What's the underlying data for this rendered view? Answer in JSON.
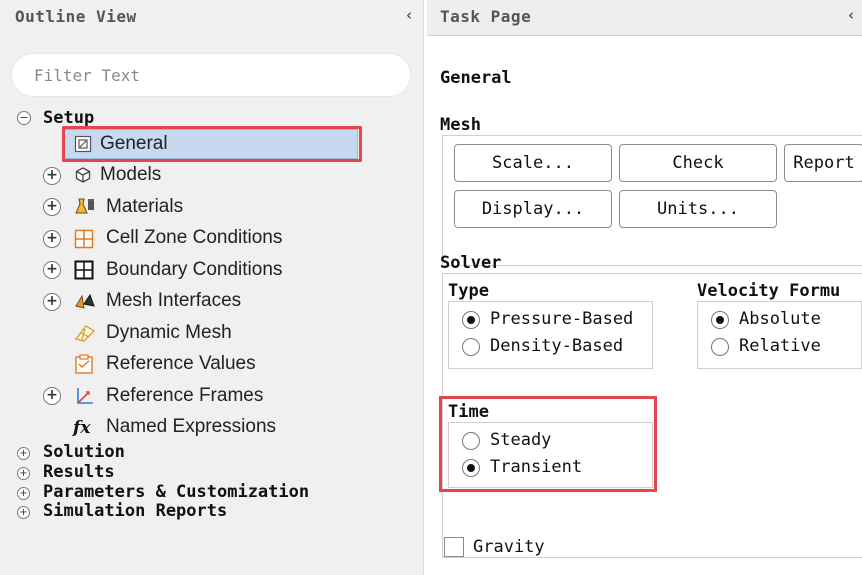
{
  "outline": {
    "title": "Outline View",
    "collapse_glyph": "‹",
    "filter_placeholder": "Filter Text",
    "setup": {
      "toggle": "−",
      "label": "Setup",
      "items": [
        {
          "label": "General",
          "icon": "general-icon"
        },
        {
          "label": "Models",
          "icon": "models-icon"
        },
        {
          "label": "Materials",
          "icon": "materials-icon"
        },
        {
          "label": "Cell Zone Conditions",
          "icon": "cell-zone-icon"
        },
        {
          "label": "Boundary Conditions",
          "icon": "boundary-icon"
        },
        {
          "label": "Mesh Interfaces",
          "icon": "mesh-interfaces-icon"
        },
        {
          "label": "Dynamic Mesh",
          "icon": "dynamic-mesh-icon"
        },
        {
          "label": "Reference Values",
          "icon": "reference-values-icon"
        },
        {
          "label": "Reference Frames",
          "icon": "reference-frames-icon"
        },
        {
          "label": "Named Expressions",
          "icon": "named-expressions-icon"
        }
      ]
    },
    "roots": [
      {
        "label": "Solution",
        "toggle": "+"
      },
      {
        "label": "Results",
        "toggle": "+"
      },
      {
        "label": "Parameters & Customization",
        "toggle": "+"
      },
      {
        "label": "Simulation Reports",
        "toggle": "+"
      }
    ],
    "expand_glyph": "+",
    "fx_glyph": "fx"
  },
  "task": {
    "title": "Task Page",
    "collapse_glyph": "‹",
    "heading": "General",
    "mesh": {
      "label": "Mesh",
      "buttons": {
        "scale": "Scale...",
        "check": "Check",
        "report": "Report",
        "display": "Display...",
        "units": "Units..."
      }
    },
    "solver": {
      "label": "Solver",
      "type": {
        "label": "Type",
        "options": [
          "Pressure-Based",
          "Density-Based"
        ],
        "selected": "Pressure-Based"
      },
      "velocity": {
        "label": "Velocity Formu",
        "options": [
          "Absolute",
          "Relative"
        ],
        "selected": "Absolute"
      },
      "time": {
        "label": "Time",
        "options": [
          "Steady",
          "Transient"
        ],
        "selected": "Transient"
      }
    },
    "gravity": {
      "label": "Gravity",
      "checked": false
    }
  },
  "colors": {
    "highlight": "#e2474b",
    "selection": "#c7d9ef"
  }
}
